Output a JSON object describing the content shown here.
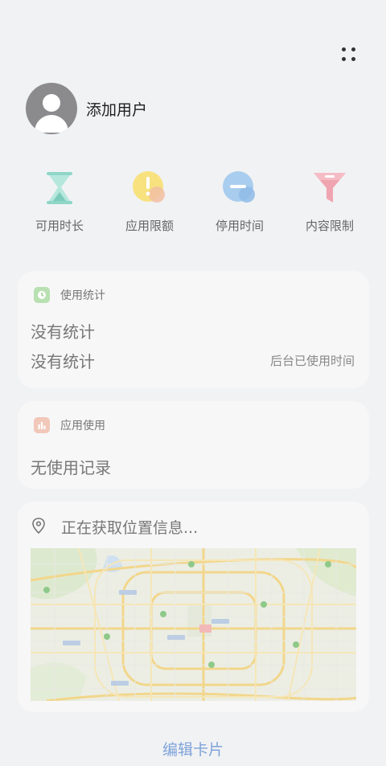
{
  "profile": {
    "name": "添加用户"
  },
  "quick_actions": [
    {
      "label": "可用时长",
      "icon": "hourglass-icon"
    },
    {
      "label": "应用限额",
      "icon": "exclamation-circle-icon"
    },
    {
      "label": "停用时间",
      "icon": "minus-circle-icon"
    },
    {
      "label": "内容限制",
      "icon": "funnel-icon"
    }
  ],
  "usage_stats": {
    "title": "使用统计",
    "line1": "没有统计",
    "line2": "没有统计",
    "background_label": "后台已使用时间"
  },
  "app_usage": {
    "title": "应用使用",
    "empty_text": "无使用记录"
  },
  "location": {
    "status_text": "正在获取位置信息..."
  },
  "footer": {
    "edit_label": "编辑卡片"
  },
  "colors": {
    "hourglass": "#a8e1d6",
    "limit": "#f5e07b",
    "downtime": "#a6cbec",
    "content": "#f0a7b1",
    "usage_badge": "#b8e0b0",
    "app_badge": "#f1c8b9",
    "link": "#7fa3d9"
  }
}
